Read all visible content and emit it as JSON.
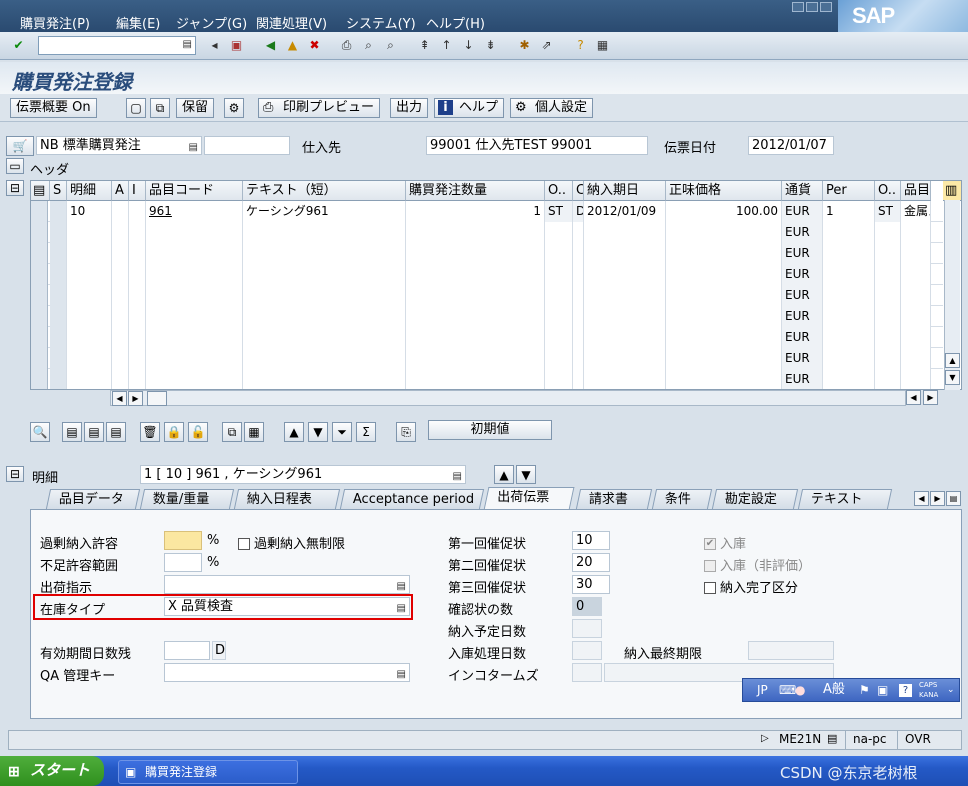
{
  "menu": [
    "購買発注(P)",
    "編集(E)",
    "ジャンプ(G)",
    "関連処理(V)",
    "システム(Y)",
    "ヘルプ(H)"
  ],
  "logo": "SAP",
  "title": "購買発注登録",
  "app_toolbar": {
    "summary": "伝票概要 On",
    "hold": "保留",
    "print_preview": "印刷プレビュー",
    "output": "出力",
    "help": "ヘルプ",
    "personal": "個人設定"
  },
  "header": {
    "doc_type": "NB 標準購買発注",
    "vendor_label": "仕入先",
    "vendor_value": "99001 仕入先TEST 99001",
    "doc_date_label": "伝票日付",
    "doc_date": "2012/01/07",
    "header_label": "ヘッダ"
  },
  "grid": {
    "columns": [
      "S",
      "明細",
      "A",
      "I",
      "品目コード",
      "テキスト（短）",
      "購買発注数量",
      "O..",
      "C",
      "納入期日",
      "正味価格",
      "通貨",
      "Per",
      "O..",
      "品目..."
    ],
    "rows": [
      [
        "",
        "10",
        "",
        "",
        "961",
        "ケーシング961",
        "1",
        "ST",
        "D",
        "2012/01/09",
        "100.00",
        "EUR",
        "1",
        "ST",
        "金属ス"
      ],
      [
        "",
        "",
        "",
        "",
        "",
        "",
        "",
        "",
        "",
        "",
        "",
        "EUR",
        "",
        "",
        ""
      ],
      [
        "",
        "",
        "",
        "",
        "",
        "",
        "",
        "",
        "",
        "",
        "",
        "EUR",
        "",
        "",
        ""
      ],
      [
        "",
        "",
        "",
        "",
        "",
        "",
        "",
        "",
        "",
        "",
        "",
        "EUR",
        "",
        "",
        ""
      ],
      [
        "",
        "",
        "",
        "",
        "",
        "",
        "",
        "",
        "",
        "",
        "",
        "EUR",
        "",
        "",
        ""
      ],
      [
        "",
        "",
        "",
        "",
        "",
        "",
        "",
        "",
        "",
        "",
        "",
        "EUR",
        "",
        "",
        ""
      ],
      [
        "",
        "",
        "",
        "",
        "",
        "",
        "",
        "",
        "",
        "",
        "",
        "EUR",
        "",
        "",
        ""
      ],
      [
        "",
        "",
        "",
        "",
        "",
        "",
        "",
        "",
        "",
        "",
        "",
        "EUR",
        "",
        "",
        ""
      ],
      [
        "",
        "",
        "",
        "",
        "",
        "",
        "",
        "",
        "",
        "",
        "",
        "EUR",
        "",
        "",
        ""
      ]
    ]
  },
  "defaults_button": "初期値",
  "item": {
    "label": "明細",
    "value": "1 [ 10 ] 961 , ケーシング961"
  },
  "tabs": [
    "品目データ",
    "数量/重量",
    "納入日程表",
    "Acceptance period",
    "出荷伝票",
    "請求書",
    "条件",
    "勘定設定",
    "テキスト"
  ],
  "active_tab": "出荷伝票",
  "form": {
    "overdelivery_label": "過剰納入許容",
    "pct1": "%",
    "unlimited_over_label": "過剰納入無制限",
    "underdelivery_label": "不足許容範囲",
    "pct2": "%",
    "shipping_instr_label": "出荷指示",
    "stock_type_label": "在庫タイプ",
    "stock_type_value": "X 品質検査",
    "shelf_life_label": "有効期間日数残",
    "shelf_life_unit": "D",
    "qa_key_label": "QA 管理キー",
    "reminder1_label": "第一回催促状",
    "reminder1": "10",
    "reminder2_label": "第二回催促状",
    "reminder2": "20",
    "reminder3_label": "第三回催促状",
    "reminder3": "30",
    "confirm_count_label": "確認状の数",
    "confirm_count": "0",
    "planned_days_label": "納入予定日数",
    "gr_days_label": "入庫処理日数",
    "latest_gr_label": "納入最終期限",
    "incoterms_label": "インコタームズ",
    "gr_label": "入庫",
    "gr_nonval_label": "入庫（非評価）",
    "delivery_complete_label": "納入完了区分"
  },
  "status": {
    "tcode": "ME21N",
    "server": "na-pc",
    "mode": "OVR"
  },
  "ime": {
    "lang": "JP",
    "mode": "A般",
    "caps": "CAPS",
    "kana": "KANA"
  },
  "taskbar": {
    "start": "スタート",
    "item": "購買発注登録",
    "watermark": "CSDN @东京老树根"
  }
}
